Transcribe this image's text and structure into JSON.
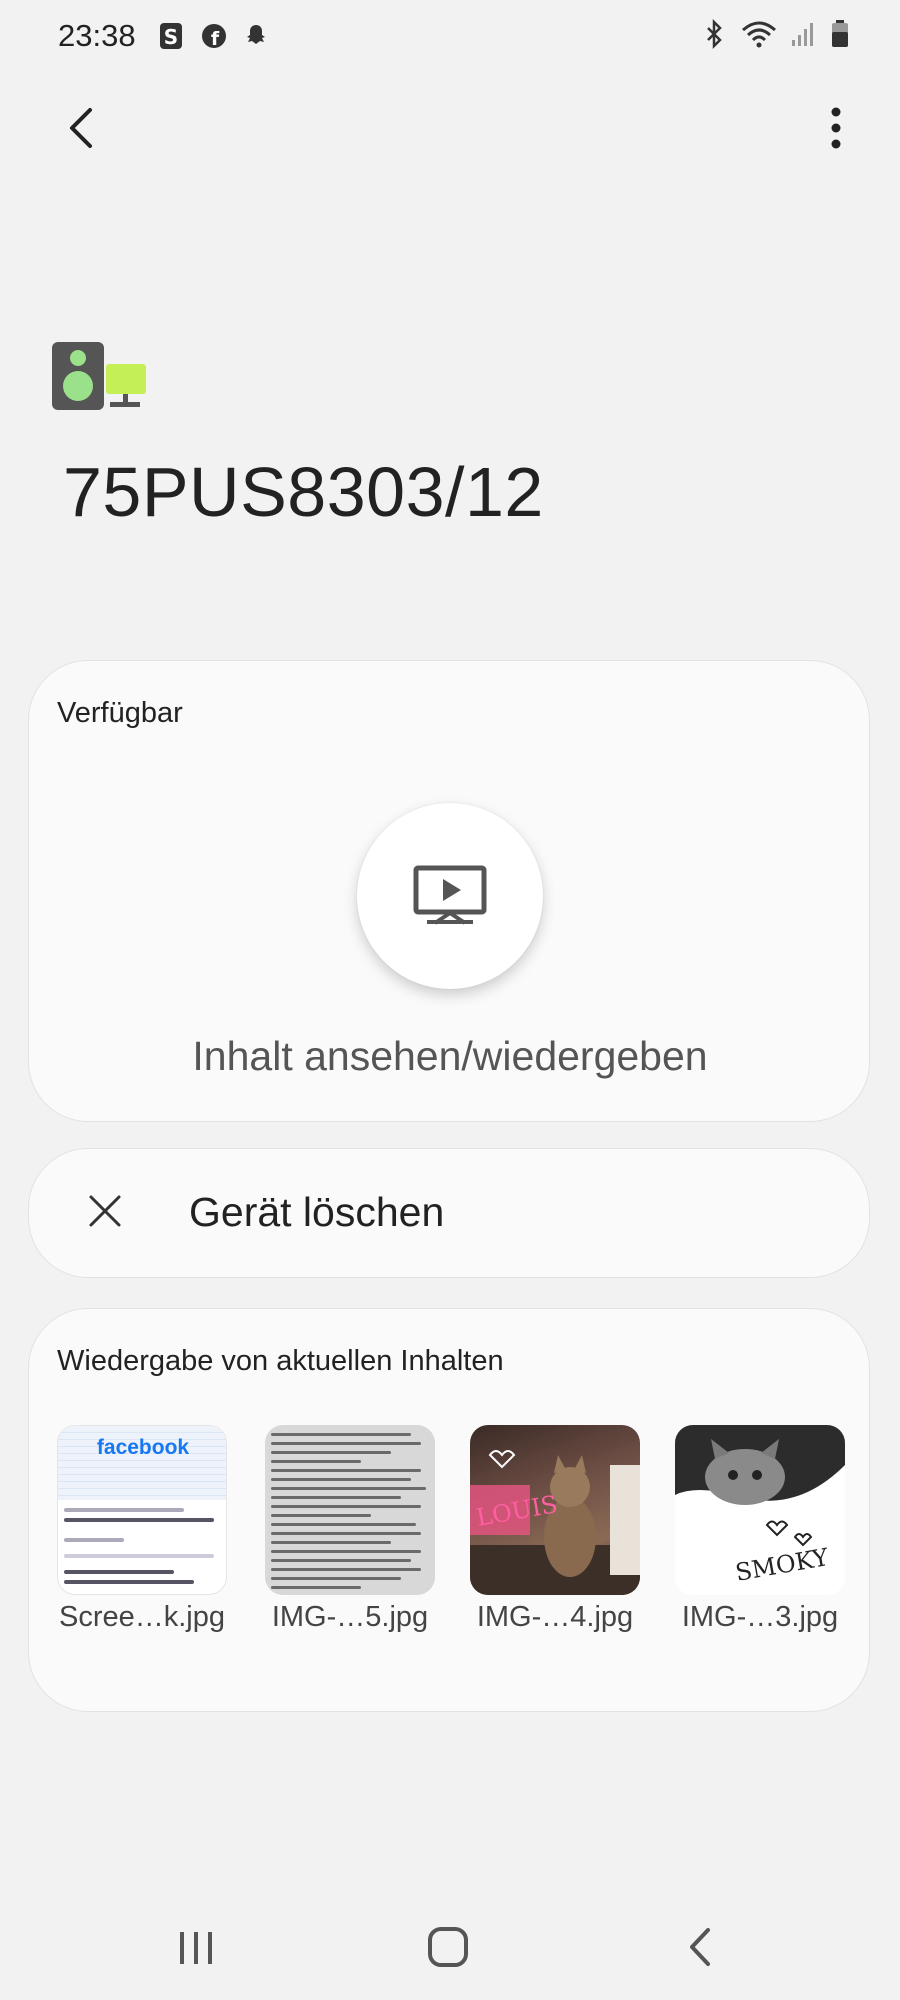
{
  "status_bar": {
    "time": "23:38",
    "app_icons": [
      "s-app-icon",
      "facebook-icon",
      "snapchat-icon"
    ],
    "right_icons": [
      "bluetooth-icon",
      "wifi-icon",
      "signal-icon",
      "battery-icon"
    ]
  },
  "header": {
    "back_icon": "chevron-left-icon",
    "more_icon": "more-vertical-icon"
  },
  "device": {
    "icon": "speaker-monitor-icon",
    "name": "75PUS8303/12"
  },
  "available_card": {
    "title": "Verfügbar",
    "action_icon": "screen-play-icon",
    "action_label": "Inhalt ansehen/wiedergeben"
  },
  "delete_card": {
    "icon": "close-icon",
    "label": "Gerät löschen"
  },
  "recent_card": {
    "title": "Wiedergabe von aktuellen Inhalten",
    "items": [
      {
        "label": "Scree…k.jpg",
        "image_text": "facebook"
      },
      {
        "label": "IMG-…5.jpg"
      },
      {
        "label": "IMG-…4.jpg",
        "image_text": "LOUIS"
      },
      {
        "label": "IMG-…3.jpg",
        "image_text": "SMOKY"
      }
    ]
  },
  "nav_bar": {
    "icons": [
      "recents-icon",
      "home-icon",
      "back-icon"
    ]
  }
}
